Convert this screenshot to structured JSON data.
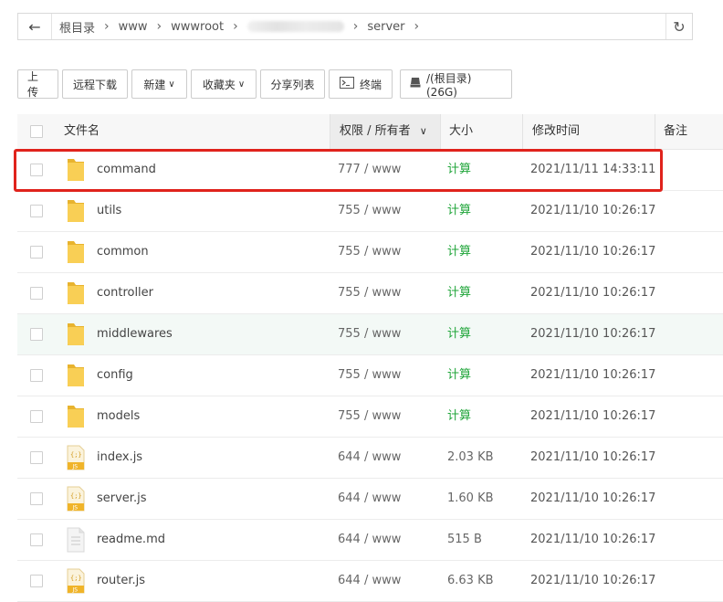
{
  "breadcrumb": {
    "segments": [
      "根目录",
      "www",
      "wwwroot",
      "server"
    ]
  },
  "toolbar": {
    "upload": "上传",
    "remote_download": "远程下载",
    "new": "新建",
    "favorites": "收藏夹",
    "share_list": "分享列表",
    "terminal": "终端",
    "disk": "/(根目录) (26G)"
  },
  "table": {
    "columns": {
      "name": "文件名",
      "permission": "权限 / 所有者",
      "size": "大小",
      "mtime": "修改时间",
      "note": "备注"
    },
    "rows": [
      {
        "name": "command",
        "type": "folder",
        "perm": "777 / www",
        "size": "计算",
        "mtime": "2021/11/11 14:33:11"
      },
      {
        "name": "utils",
        "type": "folder",
        "perm": "755 / www",
        "size": "计算",
        "mtime": "2021/11/10 10:26:17"
      },
      {
        "name": "common",
        "type": "folder",
        "perm": "755 / www",
        "size": "计算",
        "mtime": "2021/11/10 10:26:17"
      },
      {
        "name": "controller",
        "type": "folder",
        "perm": "755 / www",
        "size": "计算",
        "mtime": "2021/11/10 10:26:17"
      },
      {
        "name": "middlewares",
        "type": "folder",
        "perm": "755 / www",
        "size": "计算",
        "mtime": "2021/11/10 10:26:17"
      },
      {
        "name": "config",
        "type": "folder",
        "perm": "755 / www",
        "size": "计算",
        "mtime": "2021/11/10 10:26:17"
      },
      {
        "name": "models",
        "type": "folder",
        "perm": "755 / www",
        "size": "计算",
        "mtime": "2021/11/10 10:26:17"
      },
      {
        "name": "index.js",
        "type": "js",
        "perm": "644 / www",
        "size": "2.03 KB",
        "mtime": "2021/11/10 10:26:17"
      },
      {
        "name": "server.js",
        "type": "js",
        "perm": "644 / www",
        "size": "1.60 KB",
        "mtime": "2021/11/10 10:26:17"
      },
      {
        "name": "readme.md",
        "type": "doc",
        "perm": "644 / www",
        "size": "515 B",
        "mtime": "2021/11/10 10:26:17"
      },
      {
        "name": "router.js",
        "type": "js",
        "perm": "644 / www",
        "size": "6.63 KB",
        "mtime": "2021/11/10 10:26:17"
      }
    ]
  },
  "js_badge": "JS",
  "colors": {
    "calc_green": "#20a53a",
    "highlight_red": "#e0231c",
    "folder_yellow": "#f7c948"
  }
}
